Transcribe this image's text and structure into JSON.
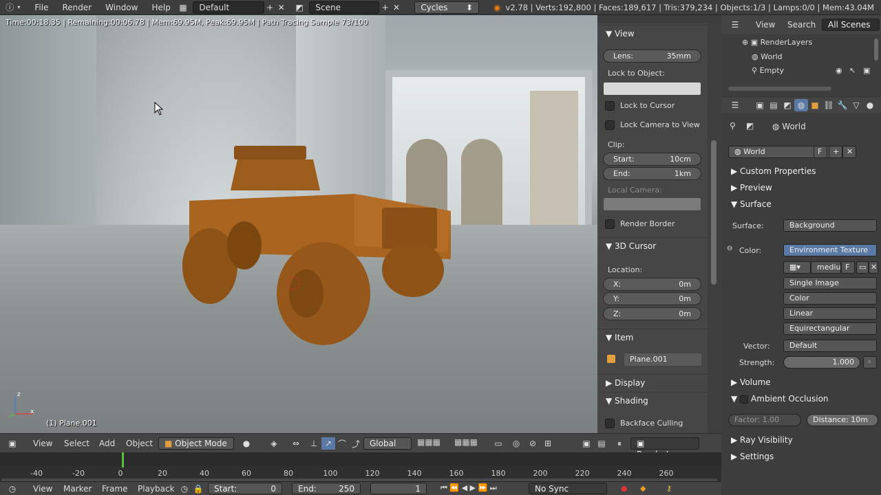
{
  "topbar": {
    "menus": [
      "File",
      "Render",
      "Window",
      "Help"
    ],
    "layout": "Default",
    "scene": "Scene",
    "engine": "Cycles Render",
    "stats": "v2.78 | Verts:192,800 | Faces:189,617 | Tris:379,234 | Objects:1/3 | Lamps:0/0 | Mem:43.04M"
  },
  "viewport": {
    "render_info": "Time:00:18.35 | Remaining:00:06.78 | Mem:69.95M, Peak:69.95M | Path Tracing Sample 73/100",
    "object_label": "(1) Plane.001",
    "axis_x": "x",
    "axis_z": "z"
  },
  "npanel": {
    "view_title": "View",
    "lens_label": "Lens:",
    "lens_value": "35mm",
    "lock_to_object": "Lock to Object:",
    "lock_to_cursor": "Lock to Cursor",
    "lock_camera": "Lock Camera to View",
    "clip": "Clip:",
    "clip_start_label": "Start:",
    "clip_start": "10cm",
    "clip_end_label": "End:",
    "clip_end": "1km",
    "local_camera": "Local Camera:",
    "render_border": "Render Border",
    "cursor_title": "3D Cursor",
    "location": "Location:",
    "x_label": "X:",
    "x_value": "0m",
    "y_label": "Y:",
    "y_value": "0m",
    "z_label": "Z:",
    "z_value": "0m",
    "item_title": "Item",
    "item_name": "Plane.001",
    "display_title": "Display",
    "shading_title": "Shading",
    "backface": "Backface Culling"
  },
  "outliner": {
    "view": "View",
    "search": "Search",
    "all_scenes": "All Scenes",
    "items": [
      "RenderLayers",
      "World",
      "Empty"
    ]
  },
  "properties": {
    "breadcrumb": "World",
    "world_name": "World",
    "fake_user": "F",
    "custom_props": "Custom Properties",
    "preview": "Preview",
    "surface": "Surface",
    "surface_label": "Surface:",
    "surface_value": "Background",
    "color_label": "Color:",
    "color_value": "Environment Texture",
    "image_name": "mediu",
    "image_f": "F",
    "source": "Single Image",
    "color_space": "Color",
    "interpolation": "Linear",
    "projection": "Equirectangular",
    "vector_label": "Vector:",
    "vector_value": "Default",
    "strength_label": "Strength:",
    "strength_value": "1.000",
    "volume": "Volume",
    "ao": "Ambient Occlusion",
    "factor": "Factor:",
    "factor_value": "1.00",
    "distance": "Distance: 10m",
    "ray_visibility": "Ray Visibility",
    "settings": "Settings"
  },
  "vp_header": {
    "view": "View",
    "select": "Select",
    "add": "Add",
    "object": "Object",
    "mode": "Object Mode",
    "orientation": "Global",
    "render_layer": "RenderLayer"
  },
  "timeline": {
    "ticks": [
      "-40",
      "-20",
      "0",
      "20",
      "40",
      "60",
      "80",
      "100",
      "120",
      "140",
      "160",
      "180",
      "200",
      "220",
      "240",
      "260"
    ],
    "view": "View",
    "marker": "Marker",
    "frame": "Frame",
    "playback": "Playback",
    "start_label": "Start:",
    "start": "0",
    "end_label": "End:",
    "end": "250",
    "current": "1",
    "sync": "No Sync"
  }
}
